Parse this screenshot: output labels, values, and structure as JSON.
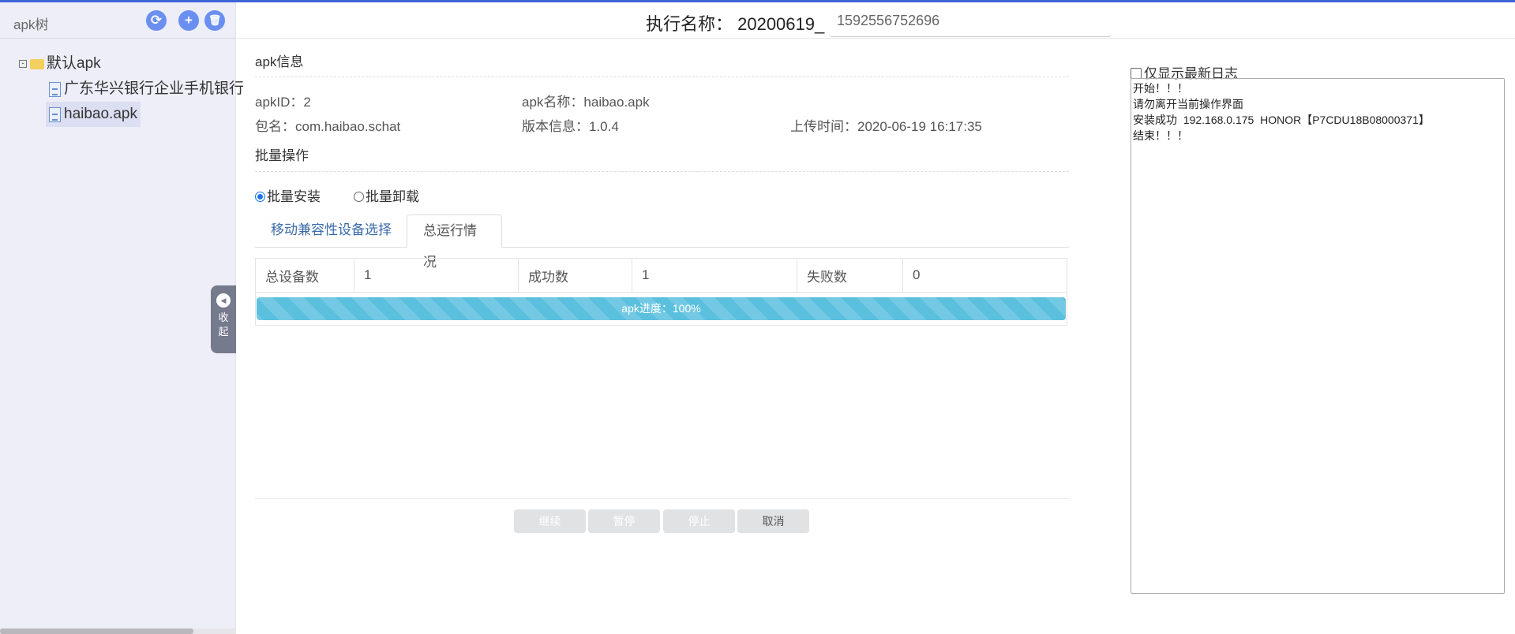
{
  "sidebar": {
    "title": "apk树",
    "tree": {
      "folder": "默认apk",
      "files": [
        "广东华兴银行企业手机银行",
        "haibao.apk"
      ]
    },
    "collapse_label": [
      "收",
      "起"
    ]
  },
  "header": {
    "label": "执行名称：  20200619_",
    "input_value": "1592556752696"
  },
  "apk_info": {
    "section": "apk信息",
    "apk_id": "apkID：2",
    "apk_name": "apk名称：haibao.apk",
    "package": "包名：com.haibao.schat",
    "version": "版本信息：1.0.4",
    "upload_time": "上传时间：2020-06-19 16:17:35"
  },
  "batch": {
    "section": "批量操作",
    "install": "批量安装",
    "uninstall": "批量卸载",
    "selected": "install"
  },
  "tabs": [
    "移动兼容性设备选择",
    "总运行情况"
  ],
  "stats": {
    "total_label": "总设备数",
    "total": "1",
    "success_label": "成功数",
    "success": "1",
    "fail_label": "失败数",
    "fail": "0"
  },
  "progress": {
    "label": "apk进度：100%",
    "percent": 100,
    "color": "#5bc0de"
  },
  "buttons": {
    "continue": "继续",
    "pause": "暂停",
    "stop": "停止",
    "cancel": "取消"
  },
  "log": {
    "checkbox_label": "仅显示最新日志",
    "lines": [
      "开始！！！",
      "请勿离开当前操作界面",
      "安装成功  192.168.0.175  HONOR【P7CDU18B08000371】",
      "结束！！！"
    ]
  }
}
